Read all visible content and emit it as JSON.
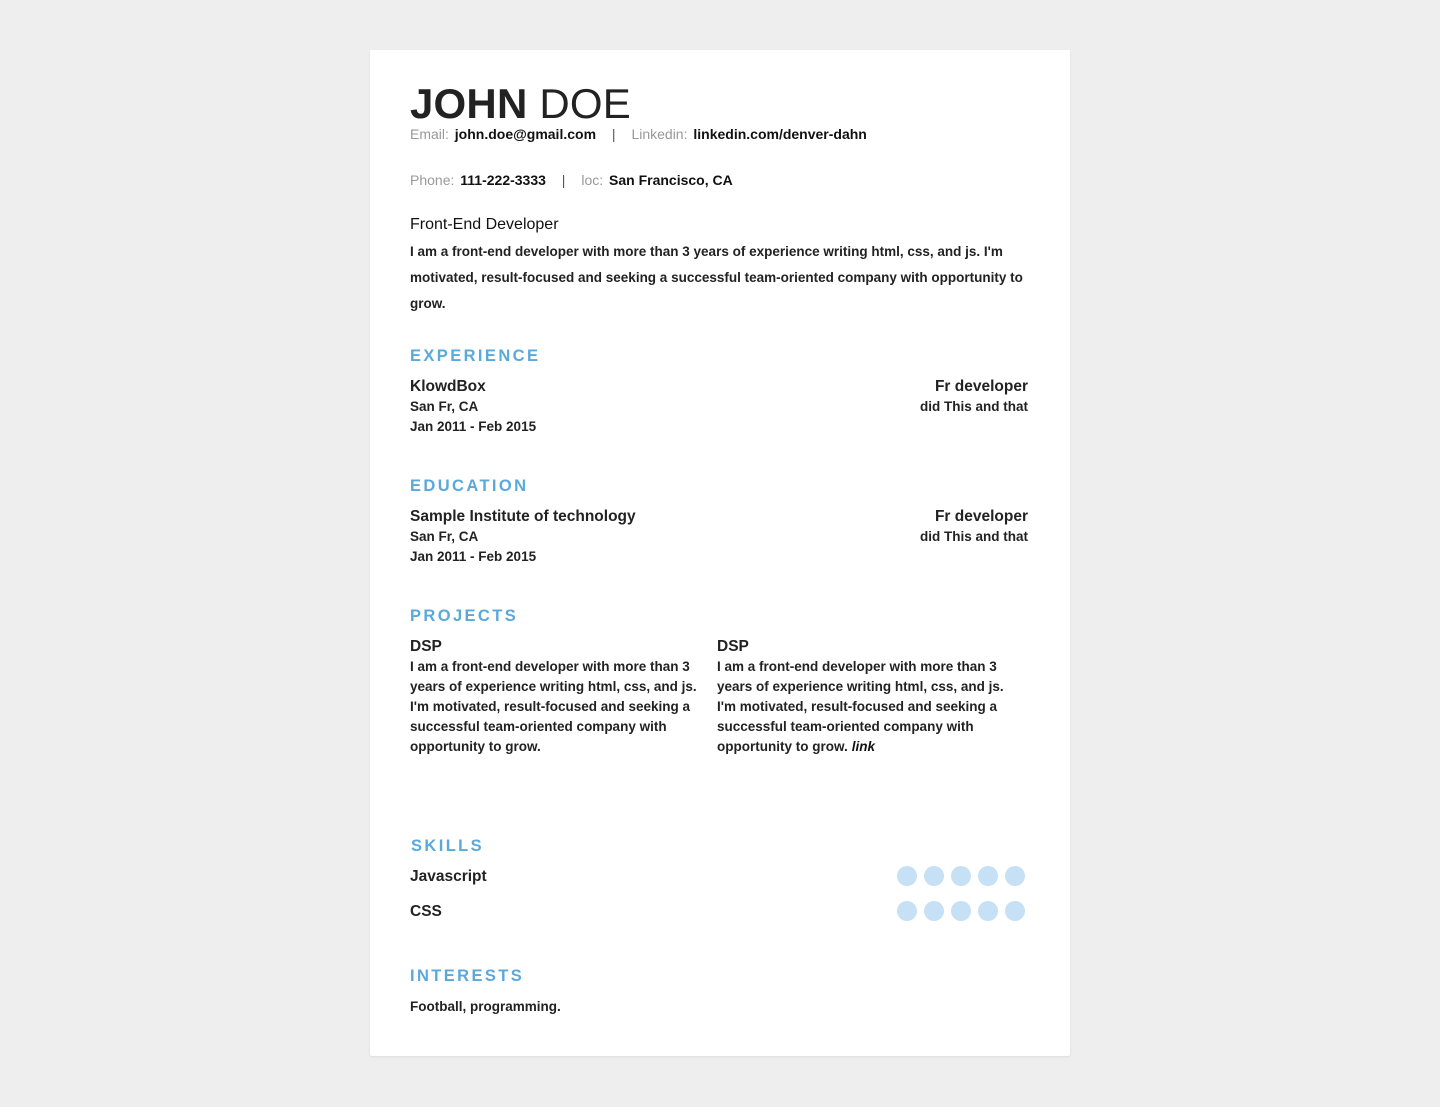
{
  "header": {
    "first_name": "JOHN",
    "last_name": "DOE",
    "email_label": "Email:",
    "email": "john.doe@gmail.com",
    "linkedin_label": "Linkedin:",
    "linkedin": "linkedin.com/denver-dahn",
    "phone_label": "Phone:",
    "phone": "111-222-3333",
    "loc_label": "loc:",
    "location": "San Francisco, CA",
    "separator": "|"
  },
  "profile": {
    "headline": "Front-End Developer",
    "summary": "I am a front-end developer with more than 3 years of experience writing html, css, and js. I'm motivated, result-focused and seeking a successful team-oriented company with opportunity to grow."
  },
  "experience": {
    "title": "EXPERIENCE",
    "items": [
      {
        "org": "KlowdBox",
        "location": "San Fr, CA",
        "dates": "Jan 2011 - Feb 2015",
        "role": "Fr developer",
        "description": "did This and that"
      }
    ]
  },
  "education": {
    "title": "EDUCATION",
    "items": [
      {
        "org": "Sample Institute of technology",
        "location": "San Fr, CA",
        "dates": "Jan 2011 - Feb 2015",
        "role": "Fr developer",
        "description": "did This and that"
      }
    ]
  },
  "projects": {
    "title": "PROJECTS",
    "items": [
      {
        "name": "DSP",
        "description": "I am a front-end developer with more than 3 years of experience writing html, css, and js. I'm motivated, result-focused and seeking a successful team-oriented company with opportunity to grow.",
        "link_label": ""
      },
      {
        "name": "DSP",
        "description": "I am a front-end developer with more than 3 years of experience writing html, css, and js. I'm motivated, result-focused and seeking a successful team-oriented company with opportunity to grow.",
        "link_label": "link"
      }
    ]
  },
  "skills": {
    "title": "SKILLS",
    "dot_color": "#c6e0f5",
    "items": [
      {
        "name": "Javascript",
        "rating": 5,
        "max": 5
      },
      {
        "name": "CSS",
        "rating": 5,
        "max": 5
      }
    ]
  },
  "interests": {
    "title": "INTERESTS",
    "text": "Football, programming."
  },
  "colors": {
    "accent": "#5aa9dc",
    "page_background": "#eeeeee",
    "card_background": "#ffffff"
  }
}
